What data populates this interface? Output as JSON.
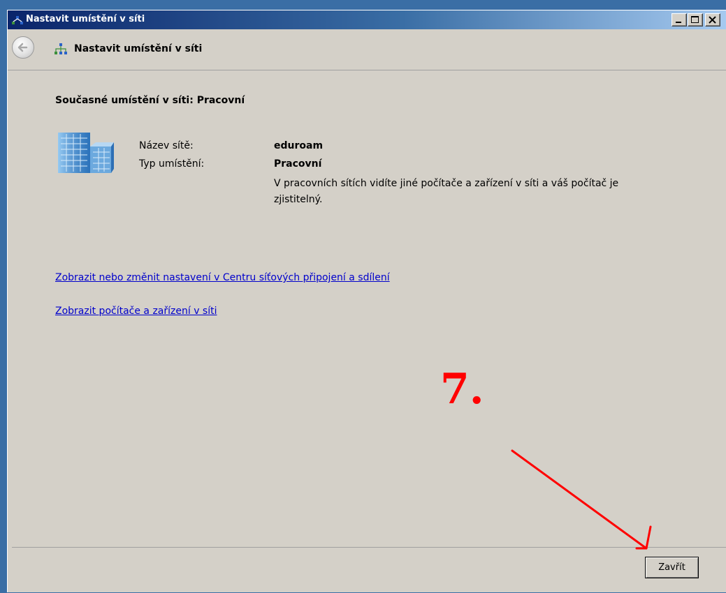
{
  "window": {
    "title": "Nastavit umístění v síti",
    "minimize_icon": "minimize-icon",
    "maximize_icon": "maximize-icon",
    "close_icon": "close-icon"
  },
  "navbar": {
    "back_icon": "back-arrow-icon",
    "title": "Nastavit umístění v síti",
    "network_icon": "network-icon"
  },
  "current_location": {
    "heading": "Současné umístění v síti: Pracovní",
    "icon": "office-building-icon",
    "network_name_label": "Název sítě:",
    "network_name_value": "eduroam",
    "location_type_label": "Typ umístění:",
    "location_type_value": "Pracovní",
    "description": "V pracovních sítích vidíte jiné počítače a zařízení v síti a váš počítač je zjistitelný."
  },
  "links": {
    "network_center": "Zobrazit nebo změnit nastavení v Centru síťových připojení a sdílení",
    "view_devices": "Zobrazit počítače a zařízení v síti"
  },
  "annotation": {
    "step_number": "7.",
    "color": "#ff0000"
  },
  "footer": {
    "close_button": "Zavřít"
  }
}
